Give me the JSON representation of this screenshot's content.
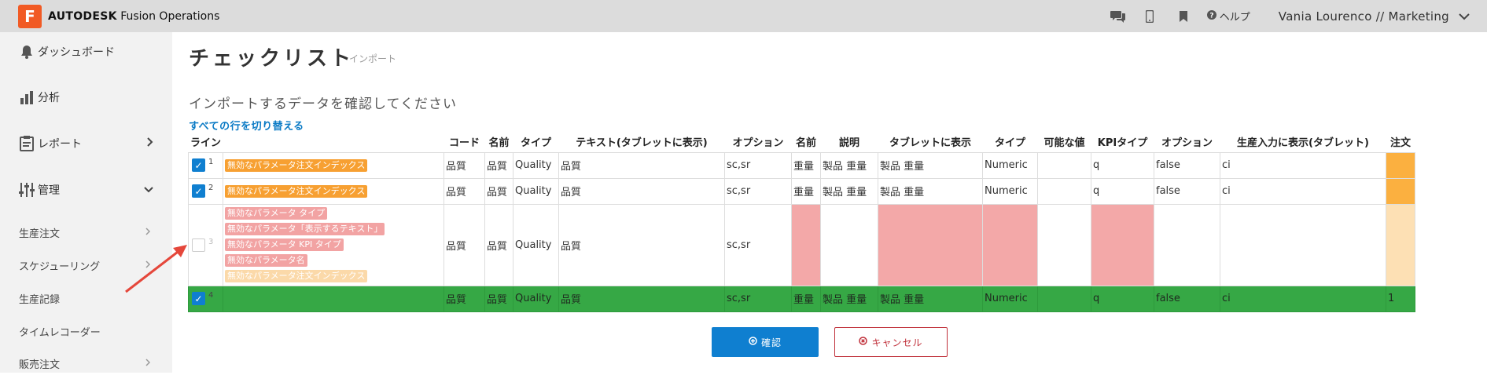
{
  "app": {
    "logo_letter": "F",
    "brand_bold": "AUTODESK",
    "brand_rest": " Fusion Operations",
    "help_label": "ヘルプ",
    "user_label": "Vania Lourenco // Marketing"
  },
  "sidebar": {
    "items": [
      {
        "label": "ダッシュボード",
        "icon": "bell-icon"
      },
      {
        "label": "分析",
        "icon": "bar-chart-icon"
      },
      {
        "label": "レポート",
        "icon": "report-icon"
      },
      {
        "label": "管理",
        "icon": "sliders-icon"
      },
      {
        "label": "生産注文"
      },
      {
        "label": "スケジューリング"
      },
      {
        "label": "生産記録"
      },
      {
        "label": "タイムレコーダー"
      },
      {
        "label": "販売注文"
      }
    ]
  },
  "page": {
    "title": "チェックリスト",
    "subtitle": "インポート",
    "confirm_message": "インポートするデータを確認してください",
    "toggle_all": "すべての行を切り替える"
  },
  "table": {
    "headers": [
      "ライン",
      "",
      "コード",
      "名前",
      "タイプ",
      "テキスト(タブレットに表示)",
      "オプション",
      "名前",
      "説明",
      "タブレットに表示",
      "タイプ",
      "可能な値",
      "KPIタイプ",
      "オプション",
      "生産入力に表示(タブレット)",
      "注文"
    ],
    "rows": [
      {
        "num": "1",
        "errors": [
          "無効なパラメータ注文インデックス"
        ],
        "code": "品質",
        "name": "品質",
        "type": "Quality",
        "text": "品質",
        "options": "sc,sr",
        "name2": "重量",
        "desc": "製品 重量",
        "tablet": "製品 重量",
        "type2": "Numeric",
        "possible": "",
        "kpi": "q",
        "option2": "false",
        "prod_input": "ci",
        "order": ""
      },
      {
        "num": "2",
        "errors": [
          "無効なパラメータ注文インデックス"
        ],
        "code": "品質",
        "name": "品質",
        "type": "Quality",
        "text": "品質",
        "options": "sc,sr",
        "name2": "重量",
        "desc": "製品 重量",
        "tablet": "製品 重量",
        "type2": "Numeric",
        "possible": "",
        "kpi": "q",
        "option2": "false",
        "prod_input": "ci",
        "order": ""
      },
      {
        "num": "3",
        "errors": [
          "無効なパラメータ タイプ",
          "無効なパラメータ「表示するテキスト」",
          "無効なパラメータ KPI タイプ",
          "無効なパラメータ名",
          "無効なパラメータ注文インデックス"
        ],
        "code": "品質",
        "name": "品質",
        "type": "Quality",
        "text": "品質",
        "options": "sc,sr",
        "name2": "",
        "desc": "",
        "tablet": "",
        "type2": "",
        "possible": "",
        "kpi": "",
        "option2": "",
        "prod_input": "",
        "order": ""
      },
      {
        "num": "4",
        "errors": [],
        "code": "品質",
        "name": "品質",
        "type": "Quality",
        "text": "品質",
        "options": "sc,sr",
        "name2": "重量",
        "desc": "製品 重量",
        "tablet": "製品 重量",
        "type2": "Numeric",
        "possible": "",
        "kpi": "q",
        "option2": "false",
        "prod_input": "ci",
        "order": "1"
      }
    ]
  },
  "buttons": {
    "confirm": "確認",
    "cancel": "キャンセル"
  },
  "colors": {
    "accent_blue": "#0f7fd0",
    "error_pink": "#f3a8a8",
    "warning_orange": "#f7a032",
    "valid_green": "#36a845",
    "cancel_red": "#c0303a"
  }
}
